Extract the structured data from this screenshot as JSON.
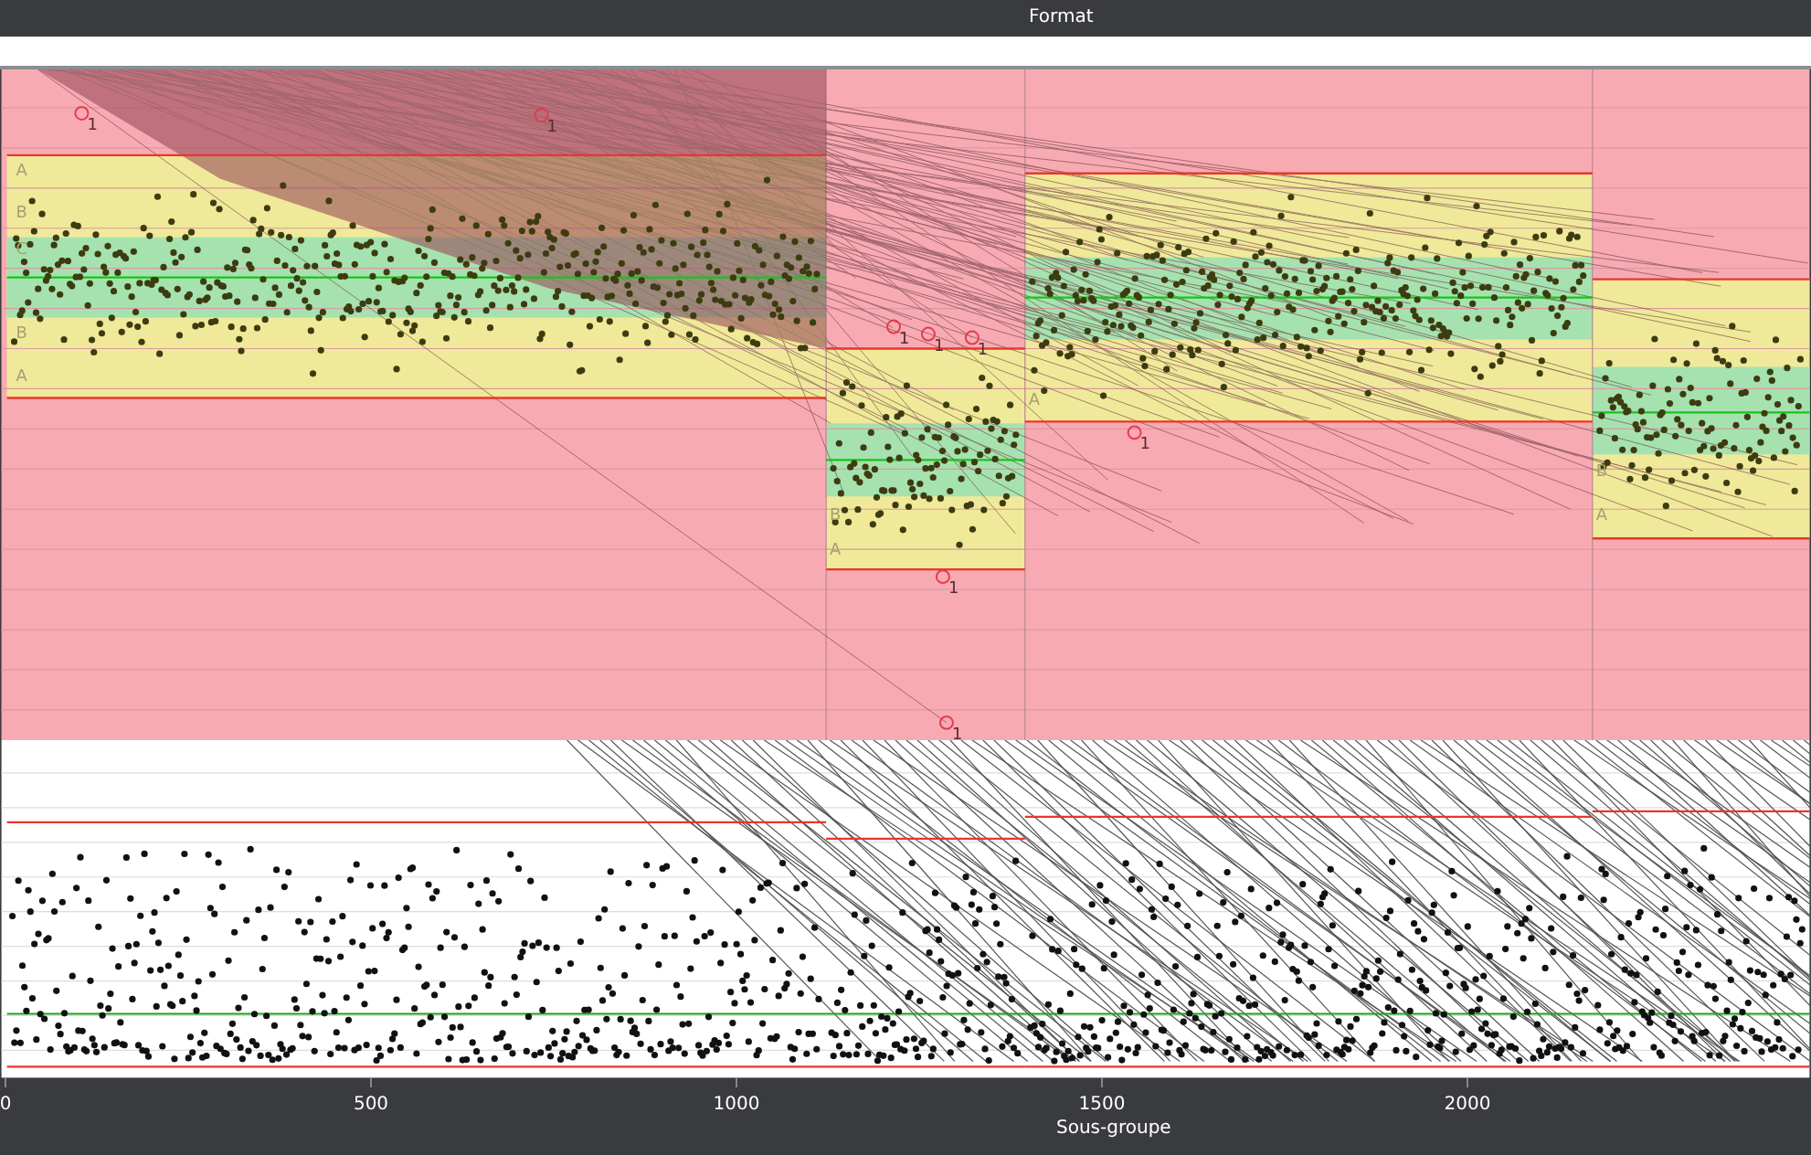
{
  "window": {
    "title": "Format"
  },
  "top_chart": {
    "zone_labels": [
      {
        "text": "A"
      },
      {
        "text": "B"
      },
      {
        "text": "C"
      },
      {
        "text": "B"
      },
      {
        "text": "A"
      },
      {
        "text": "B"
      },
      {
        "text": "A"
      },
      {
        "text": "A"
      },
      {
        "text": "B"
      },
      {
        "text": "A"
      }
    ],
    "alarm_labels": [
      {
        "text": "1"
      },
      {
        "text": "1"
      },
      {
        "text": "1"
      },
      {
        "text": "1"
      },
      {
        "text": "1"
      },
      {
        "text": "1"
      },
      {
        "text": "1"
      },
      {
        "text": "1"
      }
    ]
  },
  "x_axis": {
    "title": "Sous-groupe",
    "ticks": [
      "0",
      "500",
      "1000",
      "1500",
      "2000"
    ]
  }
}
